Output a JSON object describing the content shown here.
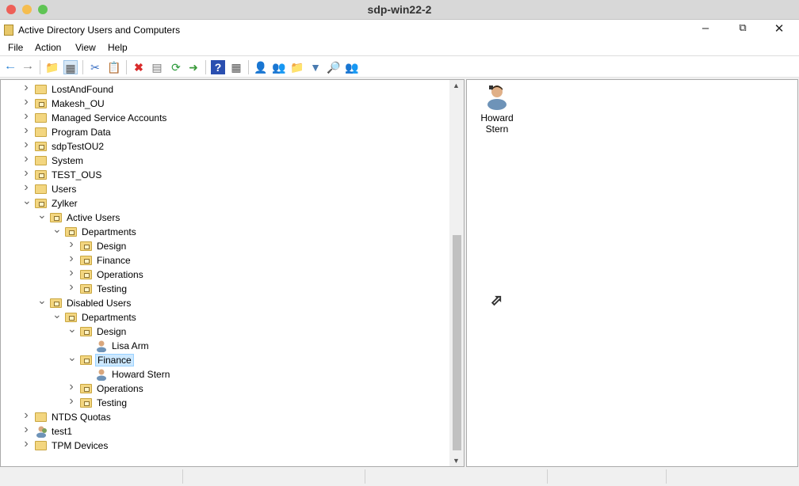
{
  "mac_title": "sdp-win22-2",
  "app_title": "Active Directory Users and Computers",
  "menu": [
    "File",
    "Action",
    "View",
    "Help"
  ],
  "toolbar": [
    "back",
    "forward",
    "up",
    "show-hide-console-tree",
    "cut",
    "paste",
    "delete",
    "properties",
    "refresh",
    "export-list",
    "help",
    "show-hide-action-pane",
    "new-user",
    "new-group",
    "new-ou",
    "filter",
    "find",
    "add-to-group"
  ],
  "tree": [
    {
      "label": "LostAndFound",
      "level": 0,
      "type": "folder",
      "state": "collapsed"
    },
    {
      "label": "Makesh_OU",
      "level": 0,
      "type": "ou",
      "state": "collapsed"
    },
    {
      "label": "Managed Service Accounts",
      "level": 0,
      "type": "folder",
      "state": "collapsed"
    },
    {
      "label": "Program Data",
      "level": 0,
      "type": "folder",
      "state": "collapsed"
    },
    {
      "label": "sdpTestOU2",
      "level": 0,
      "type": "ou",
      "state": "collapsed"
    },
    {
      "label": "System",
      "level": 0,
      "type": "folder",
      "state": "collapsed"
    },
    {
      "label": "TEST_OUS",
      "level": 0,
      "type": "ou",
      "state": "collapsed"
    },
    {
      "label": "Users",
      "level": 0,
      "type": "folder",
      "state": "collapsed"
    },
    {
      "label": "Zylker",
      "level": 0,
      "type": "ou",
      "state": "expanded"
    },
    {
      "label": "Active Users",
      "level": 1,
      "type": "ou",
      "state": "expanded"
    },
    {
      "label": "Departments",
      "level": 2,
      "type": "ou",
      "state": "expanded"
    },
    {
      "label": "Design",
      "level": 3,
      "type": "ou",
      "state": "collapsed"
    },
    {
      "label": "Finance",
      "level": 3,
      "type": "ou",
      "state": "collapsed"
    },
    {
      "label": "Operations",
      "level": 3,
      "type": "ou",
      "state": "collapsed"
    },
    {
      "label": "Testing",
      "level": 3,
      "type": "ou",
      "state": "collapsed"
    },
    {
      "label": "Disabled Users",
      "level": 1,
      "type": "ou",
      "state": "expanded"
    },
    {
      "label": "Departments",
      "level": 2,
      "type": "ou",
      "state": "expanded"
    },
    {
      "label": "Design",
      "level": 3,
      "type": "ou",
      "state": "expanded"
    },
    {
      "label": "Lisa Arm",
      "level": 4,
      "type": "user",
      "state": "none"
    },
    {
      "label": "Finance",
      "level": 3,
      "type": "ou",
      "state": "expanded",
      "selected": true
    },
    {
      "label": "Howard Stern",
      "level": 4,
      "type": "user",
      "state": "none"
    },
    {
      "label": "Operations",
      "level": 3,
      "type": "ou",
      "state": "collapsed"
    },
    {
      "label": "Testing",
      "level": 3,
      "type": "ou",
      "state": "collapsed"
    },
    {
      "label": "NTDS Quotas",
      "level": 0,
      "type": "folder",
      "state": "collapsed"
    },
    {
      "label": "test1",
      "level": 0,
      "type": "group",
      "state": "collapsed"
    },
    {
      "label": "TPM Devices",
      "level": 0,
      "type": "folder",
      "state": "collapsed"
    }
  ],
  "details": [
    {
      "line1": "Howard",
      "line2": "Stern"
    }
  ]
}
